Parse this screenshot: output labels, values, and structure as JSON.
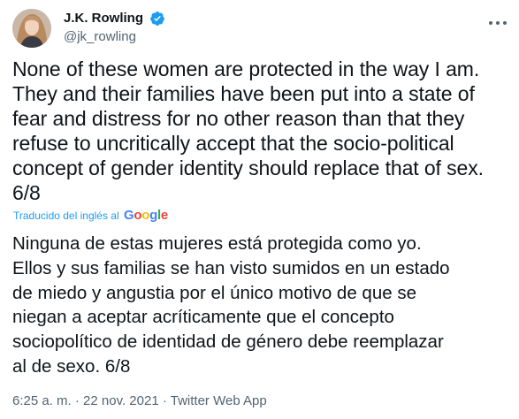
{
  "author": {
    "name": "J.K. Rowling",
    "handle": "@jk_rowling",
    "verified": true,
    "verified_icon": "verified-badge-icon"
  },
  "tweet": {
    "text": "None of these women are protected in the way I am.\nThey and their families have been put into a state of\nfear and distress for no other reason than that they\nrefuse to uncritically accept that the socio-political\nconcept of gender identity should replace that of sex.\n6/8",
    "translation_label": "Traducido del inglés al",
    "translation_provider": "Google",
    "translation": "Ninguna de estas mujeres está protegida como yo.\nEllos y sus familias se han visto sumidos en un estado\nde miedo y angustia por el único motivo de que se\nniegan a aceptar acríticamente que el concepto\nsociopolítico de identidad de género debe reemplazar\nal de sexo. 6/8"
  },
  "meta": {
    "time": "6:25 a. m.",
    "date": "22 nov. 2021",
    "source": "Twitter Web App",
    "separator": " · "
  },
  "colors": {
    "text": "#0f1419",
    "secondary": "#536471",
    "accent": "#1d9bf0",
    "google_blue": "#4285f4",
    "google_red": "#ea4335",
    "google_yellow": "#fbbc05",
    "google_green": "#34a853"
  },
  "icons": {
    "more": "more-options-icon",
    "avatar": "avatar"
  }
}
